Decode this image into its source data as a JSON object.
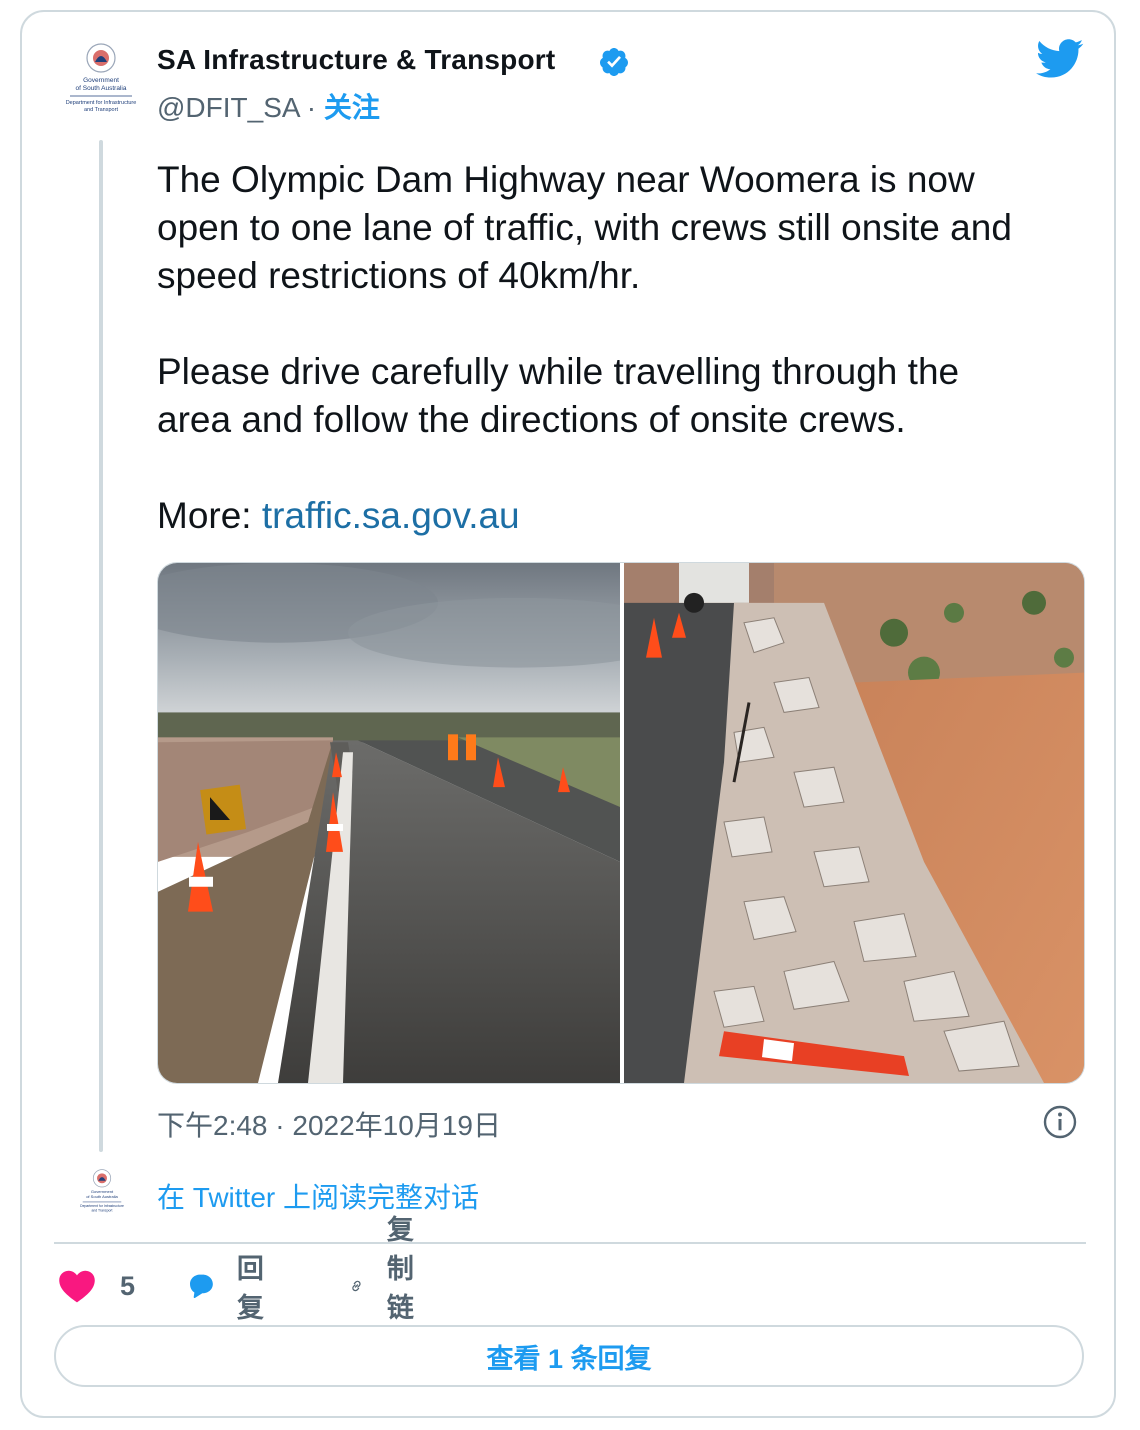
{
  "account": {
    "name": "SA Infrastructure & Transport",
    "handle": "@DFIT_SA",
    "separator": " · ",
    "follow_label": "关注",
    "logo_line1": "Government",
    "logo_line2": "of South Australia",
    "logo_line3": "Department for Infrastructure",
    "logo_line4": "and Transport"
  },
  "tweet": {
    "line1": "The Olympic Dam Highway near Woomera is now",
    "line2": "open to one lane of traffic, with crews still onsite and",
    "line3": "speed restrictions of 40km/hr.",
    "line4": "Please drive carefully while travelling through the",
    "line5": "area and follow the directions of onsite crews.",
    "more_label": "More: ",
    "link_text": "traffic.sa.gov.au"
  },
  "timestamp": "下午2:48 · 2022年10月19日",
  "read_full": "在 Twitter 上阅读完整对话",
  "actions": {
    "like_count": "5",
    "reply_label": "回复",
    "copy_link_label": "复制链接"
  },
  "view_replies_label": "查看 1 条回复",
  "colors": {
    "accent": "#1d9bf0",
    "like": "#f91880",
    "border": "#cfd9de",
    "secondary_text": "#536471"
  },
  "icons": [
    "twitter-bird-icon",
    "verified-badge-icon",
    "info-icon",
    "heart-icon",
    "reply-bubble-icon",
    "link-icon"
  ]
}
